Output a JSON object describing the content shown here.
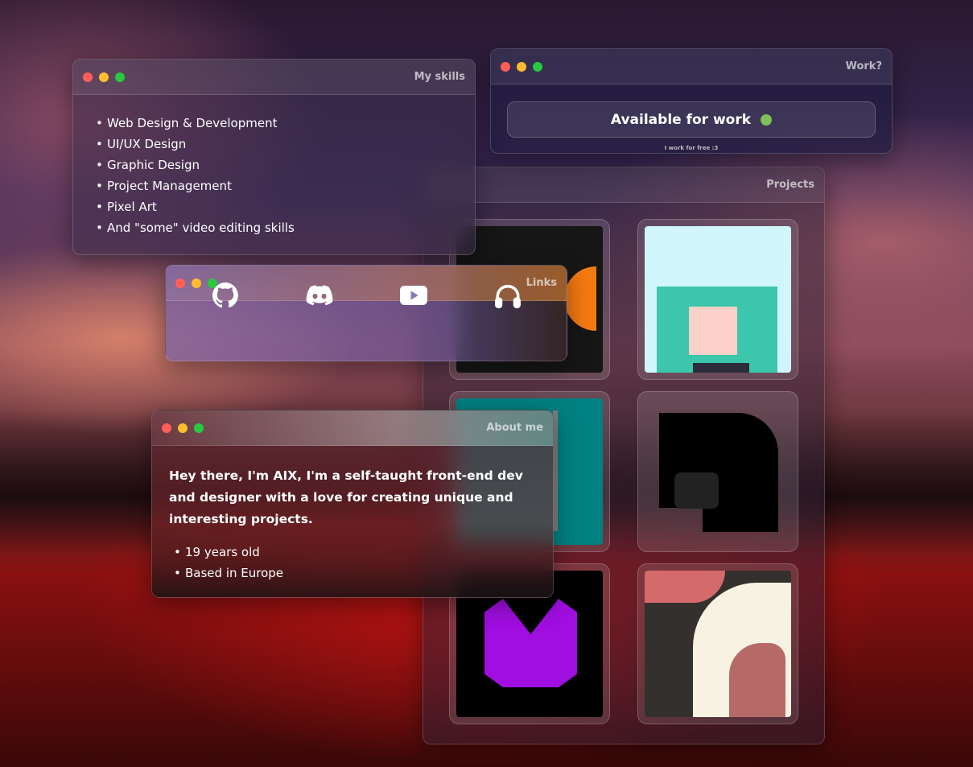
{
  "skills": {
    "title": "My skills",
    "items": [
      "Web Design & Development",
      "UI/UX Design",
      "Graphic Design",
      "Project Management",
      "Pixel Art",
      "And \"some\" video editing skills"
    ]
  },
  "work": {
    "title": "Work?",
    "button": "Available for work",
    "status_color": "#7fbf5a",
    "note": "I work for free :3"
  },
  "projects": {
    "title": "Projects",
    "tiles": [
      "orange-shape-logo",
      "pixel-art-miku",
      "teal-waveform",
      "black-rounded-shape",
      "purple-v-logo",
      "horn-illustration"
    ]
  },
  "links": {
    "title": "Links",
    "icons": [
      "github-icon",
      "discord-icon",
      "youtube-icon",
      "headphones-icon"
    ]
  },
  "about": {
    "title": "About me",
    "intro": "Hey there, I'm AIX, I'm a self-taught front-end dev and designer with a love for creating unique and interesting projects.",
    "items": [
      "19 years old",
      "Based in Europe"
    ]
  }
}
